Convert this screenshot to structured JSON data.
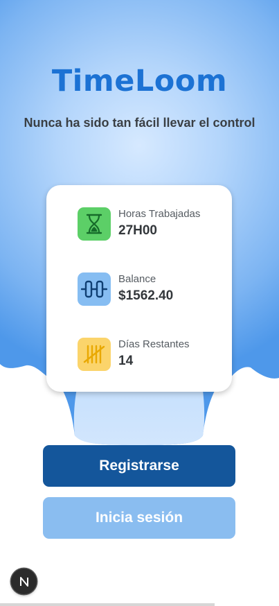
{
  "app": {
    "title": "TimeLoom",
    "tagline": "Nunca ha sido tan fácil llevar el control"
  },
  "stats": [
    {
      "label": "Horas Trabajadas",
      "value": "27H00",
      "icon": "hourglass-icon",
      "color": "#5ccf67"
    },
    {
      "label": "Balance",
      "value": "$1562.40",
      "icon": "balance-icon",
      "color": "#86bdf2"
    },
    {
      "label": "Días Restantes",
      "value": "14",
      "icon": "tally-icon",
      "color": "#fbd46b"
    }
  ],
  "actions": {
    "register_label": "Registrarse",
    "login_label": "Inicia sesión"
  },
  "colors": {
    "brand": "#1c72d4",
    "primary_button": "#14569b",
    "secondary_button": "#8abdf0"
  }
}
